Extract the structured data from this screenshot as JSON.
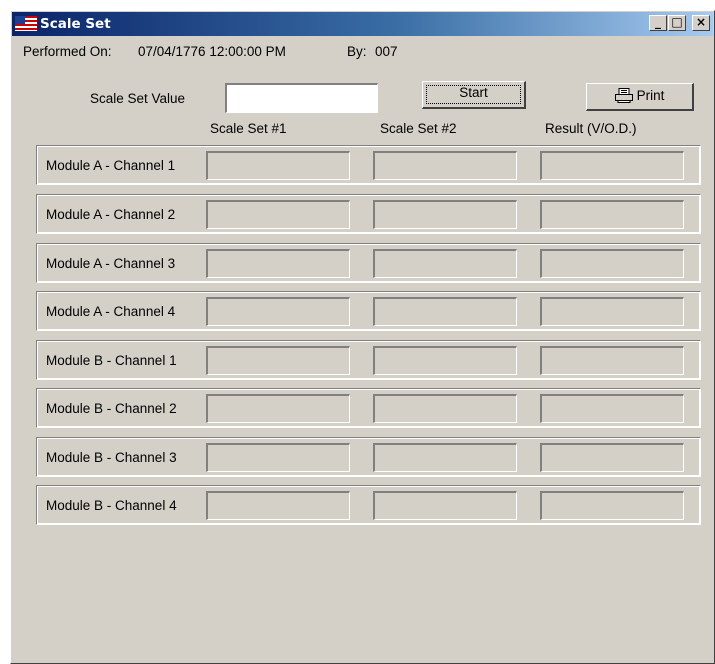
{
  "window": {
    "title": "Scale Set",
    "controls": {
      "minimize": "_",
      "maximize": "□",
      "close": "×"
    }
  },
  "header": {
    "performed_on_label": "Performed On:",
    "performed_on_value": "07/04/1776 12:00:00 PM",
    "by_label": "By:",
    "by_value": "007"
  },
  "scale_set_value": {
    "label": "Scale Set Value",
    "value": ""
  },
  "buttons": {
    "start": "Start",
    "print": "Print"
  },
  "columns": [
    "Scale Set #1",
    "Scale Set #2",
    "Result (V/O.D.)"
  ],
  "rows": [
    {
      "label": "Module A - Channel 1",
      "values": [
        "",
        "",
        ""
      ]
    },
    {
      "label": "Module A - Channel 2",
      "values": [
        "",
        "",
        ""
      ]
    },
    {
      "label": "Module A - Channel 3",
      "values": [
        "",
        "",
        ""
      ]
    },
    {
      "label": "Module A - Channel 4",
      "values": [
        "",
        "",
        ""
      ]
    },
    {
      "label": "Module B - Channel 1",
      "values": [
        "",
        "",
        ""
      ]
    },
    {
      "label": "Module B - Channel 2",
      "values": [
        "",
        "",
        ""
      ]
    },
    {
      "label": "Module B - Channel 3",
      "values": [
        "",
        "",
        ""
      ]
    },
    {
      "label": "Module B - Channel 4",
      "values": [
        "",
        "",
        ""
      ]
    }
  ],
  "icons": {
    "app": "flag-icon",
    "print": "printer-icon"
  },
  "colors": {
    "face": "#d4d0c8",
    "title_start": "#0a246a",
    "title_end": "#a6caf0"
  }
}
